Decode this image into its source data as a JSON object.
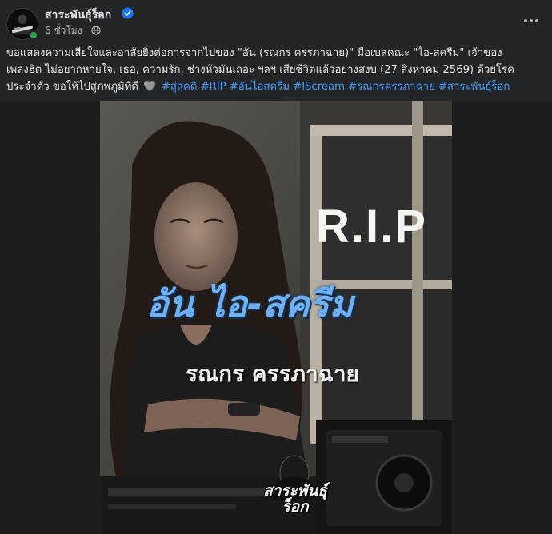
{
  "post": {
    "page_name": "สาระพันธุ์ร็อก",
    "verified": true,
    "time": "6 ชั่วโมง",
    "privacy_icon": "globe-icon",
    "more_icon": "more-horizontal-icon",
    "caption": {
      "line1": "ขอแสดงความเสียใจและอาลัยยิ่งต่อการจากไปของ \"อัน (รณกร ครรภาฉาย)\" มือเบสคณะ \"ไอ-สครีม\" เจ้าของ",
      "line2": "เพลงฮิต ไม่อยากหายใจ, เธอ, ความรัก, ช่างหัวมันเถอะ ฯลฯ เสียชีวิตแล้วอย่างสงบ (27 สิงหาคม 2569) ด้วยโรค",
      "line3_text": "ประจำตัว ขอให้ไปสู่ภพภูมิที่ดี",
      "heart": "🩶",
      "hashtags": [
        "#สู่สุคติ",
        "#RIP",
        "#อันไอสครีม",
        "#IScream",
        "#รณกรครรภาฉาย",
        "#สาระพันธุ์ร็อก"
      ]
    },
    "image": {
      "rip_text": "R.I.P",
      "name_text": "อัน ไอ-สครีม",
      "fullname_text": "รณกร ครรภาฉาย",
      "logo_text_line1": "สาระพันธุ์",
      "logo_text_line2": "ร็อก"
    },
    "colors": {
      "background": "#242526",
      "text": "#e4e6eb",
      "muted": "#b0b3b8",
      "hashtag": "#4599ff",
      "verified": "#1877f2",
      "name_blue": "#6fb0f2"
    }
  }
}
